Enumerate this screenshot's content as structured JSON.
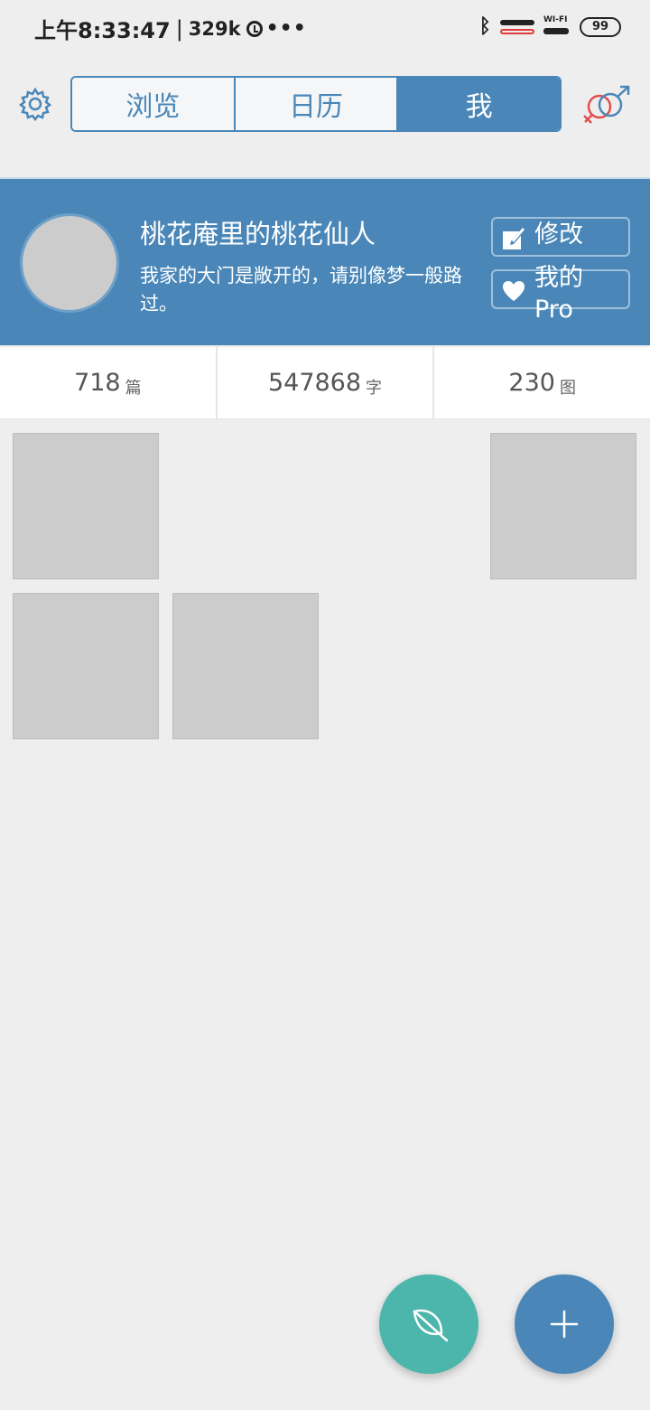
{
  "status_bar": {
    "time": "上午8:33:47",
    "separator": "|",
    "speed": "329k",
    "more": "•••",
    "battery": "99"
  },
  "nav": {
    "tabs": [
      {
        "label": "浏览",
        "active": false
      },
      {
        "label": "日历",
        "active": false
      },
      {
        "label": "我",
        "active": true
      }
    ],
    "settings_icon": "gear-icon",
    "gender_icon": "gender-icon"
  },
  "profile": {
    "username": "桃花庵里的桃花仙人",
    "bio": "我家的大门是敞开的，请别像梦一般路过。",
    "edit_label": "修改",
    "pro_label": "我的Pro"
  },
  "stats": [
    {
      "value": "718",
      "unit": "篇"
    },
    {
      "value": "547868",
      "unit": "字"
    },
    {
      "value": "230",
      "unit": "图"
    }
  ],
  "colors": {
    "accent": "#4a87b8",
    "teal": "#4db6ac",
    "background": "#eeeeee",
    "signal_red": "#e23a3a",
    "gender_red": "#e05050"
  },
  "fabs": [
    {
      "icon": "leaf-icon"
    },
    {
      "icon": "plus-icon"
    }
  ]
}
